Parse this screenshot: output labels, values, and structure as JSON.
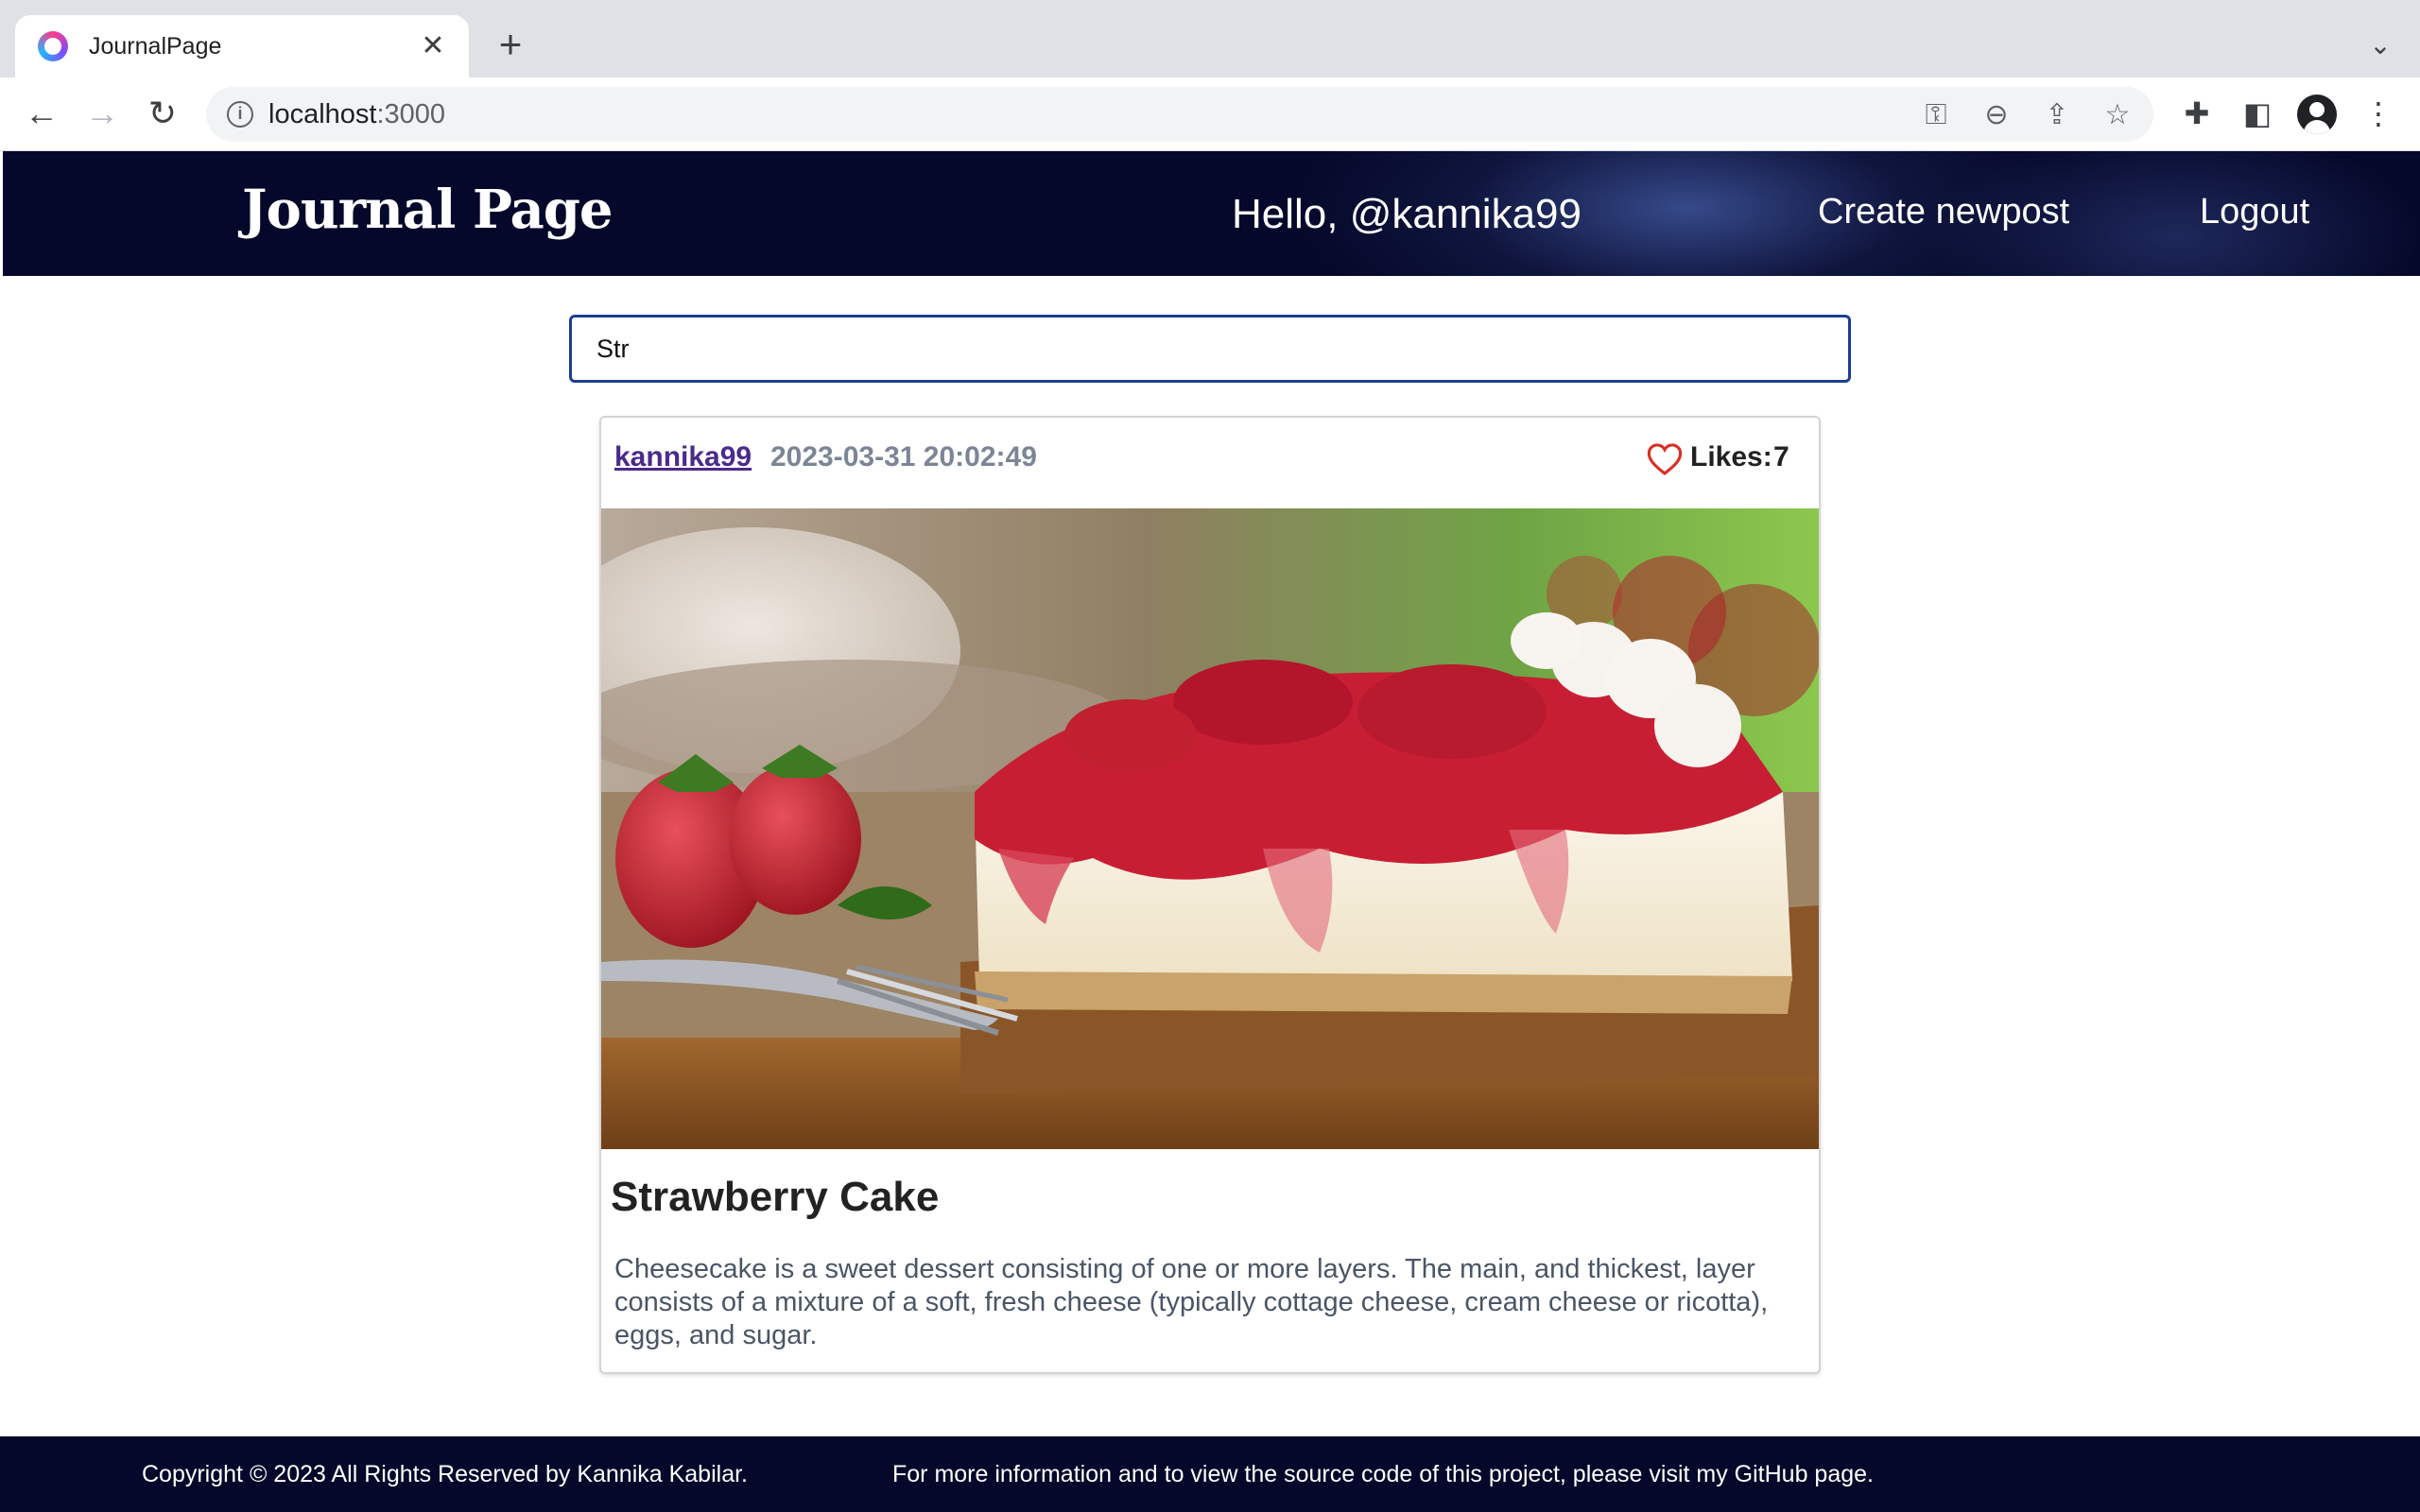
{
  "browser": {
    "tab_title": "JournalPage",
    "url_host": "localhost",
    "url_port": ":3000"
  },
  "header": {
    "logo": "Journal Page",
    "greeting": "Hello, @kannika99",
    "create_label": "Create newpost",
    "logout_label": "Logout"
  },
  "search": {
    "value": "Str"
  },
  "post": {
    "author": "kannika99",
    "date": "2023-03-31 20:02:49",
    "likes_label": "Likes:",
    "likes_count": "7",
    "title": "Strawberry Cake",
    "body": "Cheesecake is a sweet dessert consisting of one or more layers. The main, and thickest, layer consists of a mixture of a soft, fresh cheese (typically cottage cheese, cream cheese or ricotta), eggs, and sugar.",
    "image_subject": "strawberry cheesecake slice"
  },
  "footer": {
    "copyright": "Copyright © 2023 All Rights Reserved by Kannika Kabilar.",
    "info": "For more information and to view the source code of this project, please visit my GitHub page."
  },
  "colors": {
    "header_bg": "#05082a",
    "search_border": "#1a3f94",
    "author_link": "#4b2a8a",
    "date_text": "#7c8595",
    "heart": "#d93025"
  }
}
